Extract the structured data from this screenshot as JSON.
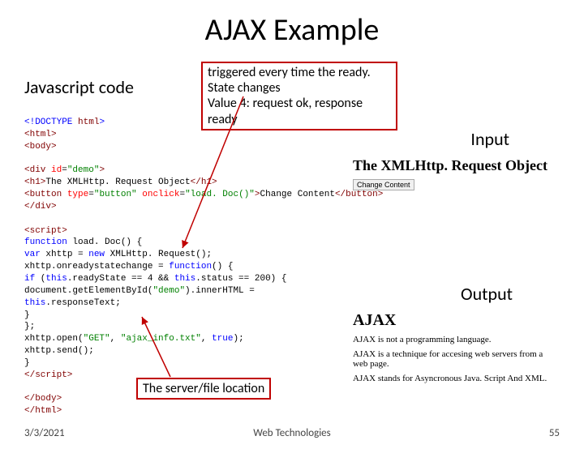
{
  "title": "AJAX Example",
  "labels": {
    "js": "Javascript code",
    "input": "Input",
    "output": "Output"
  },
  "callouts": {
    "top_line1": "triggered every time the ready. State changes",
    "top_line2": "Value 4: request ok, response ready",
    "bottom": "The server/file location"
  },
  "code": {
    "l1a": "<!DOCTYPE",
    "l1b": " html",
    "l1c": ">",
    "l2": "<html>",
    "l3": "<body>",
    "l4a": "<div",
    "l4b": " id",
    "l4c": "=",
    "l4d": "\"demo\"",
    "l4e": ">",
    "l5a": "<h1>",
    "l5b": "The XMLHttp. Request Object",
    "l5c": "</h1>",
    "l6a": "<button",
    "l6b": " type",
    "l6c": "=",
    "l6d": "\"button\"",
    "l6e": " onclick",
    "l6f": "=",
    "l6g": "\"load. Doc()\"",
    "l6h": ">",
    "l6i": "Change Content",
    "l6j": "</button>",
    "l7": "</div>",
    "l8": "<script>",
    "l9a": "function",
    "l9b": " load. Doc() {",
    "l10a": "  var",
    "l10b": " xhttp = ",
    "l10c": "new",
    "l10d": " XMLHttp. Request();",
    "l11": "  xhttp.onreadystatechange = ",
    "l11b": "function",
    "l11c": "() {",
    "l12a": "    if",
    "l12b": " (",
    "l12c": "this",
    "l12d": ".readyState == 4 && ",
    "l12e": "this",
    "l12f": ".status == 200) {",
    "l13a": "      document.getElementById(",
    "l13b": "\"demo\"",
    "l13c": ").innerHTML =",
    "l14a": "      this",
    "l14b": ".responseText;",
    "l15": "    }",
    "l16": "  };",
    "l17a": "  xhttp.open(",
    "l17b": "\"GET\"",
    "l17c": ", ",
    "l17d": "\"ajax_info.txt\"",
    "l17e": ", ",
    "l17f": "true",
    "l17g": ");",
    "l18": "  xhttp.send();",
    "l19": "}",
    "l20": "</script>",
    "l21": "</body>",
    "l22": "</html>"
  },
  "input_preview": {
    "heading": "The XMLHttp. Request Object",
    "button": "Change Content"
  },
  "output_preview": {
    "heading": "AJAX",
    "p1": "AJAX is not a programming language.",
    "p2": "AJAX is a technique for accesing web servers from a web page.",
    "p3": "AJAX stands for Asyncronous Java. Script And XML."
  },
  "footer": {
    "date": "3/3/2021",
    "center": "Web Technologies",
    "page": "55"
  }
}
